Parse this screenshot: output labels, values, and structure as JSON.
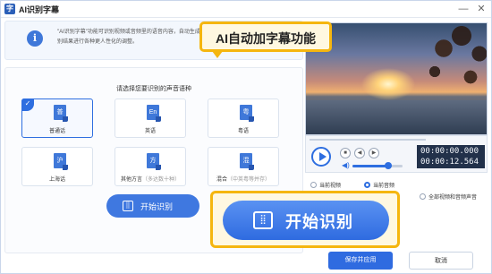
{
  "titlebar": {
    "title": "AI识别字幕",
    "app_icon": "字",
    "minimize": "—",
    "close": "✕"
  },
  "info": {
    "icon": "i",
    "text": "\"AI识别字幕\"功能可识别视频或音频里的语音内容，自动生成字幕，识别结果进行各种更人性化的调整。"
  },
  "callout_top": {
    "text": "AI自动加字幕功能"
  },
  "panel": {
    "title": "请选择您要识别的声音语种",
    "languages": [
      {
        "badge": "普",
        "label": "普通话",
        "sub": "",
        "selected": true
      },
      {
        "badge": "En",
        "label": "英语",
        "sub": "",
        "selected": false
      },
      {
        "badge": "粤",
        "label": "粤语",
        "sub": "",
        "selected": false
      },
      {
        "badge": "沪",
        "label": "上海话",
        "sub": "",
        "selected": false
      },
      {
        "badge": "方",
        "label": "其他方言",
        "sub": "（多达数十种）",
        "selected": false
      },
      {
        "badge": "混",
        "label": "混合",
        "sub": "（中英粤等并存）",
        "selected": false
      }
    ],
    "check_icon": "✓",
    "start_button": {
      "label": "开始识别",
      "icon": "⣿"
    }
  },
  "player": {
    "time_current": "00:00:00.000",
    "time_total": "00:00:12.564",
    "volume_level": 0.72,
    "controls": [
      "■",
      "◀",
      "▶"
    ],
    "volume_icon": "◀)"
  },
  "options": {
    "items": [
      {
        "label": "当前视频",
        "selected": false
      },
      {
        "label": "当前音频",
        "selected": true
      },
      {
        "label": "全部视频和音频声音",
        "selected": false
      }
    ]
  },
  "big_button": {
    "label": "开始识别",
    "icon": "⣿"
  },
  "footer": {
    "apply": "保存并应用",
    "cancel": "取消"
  }
}
